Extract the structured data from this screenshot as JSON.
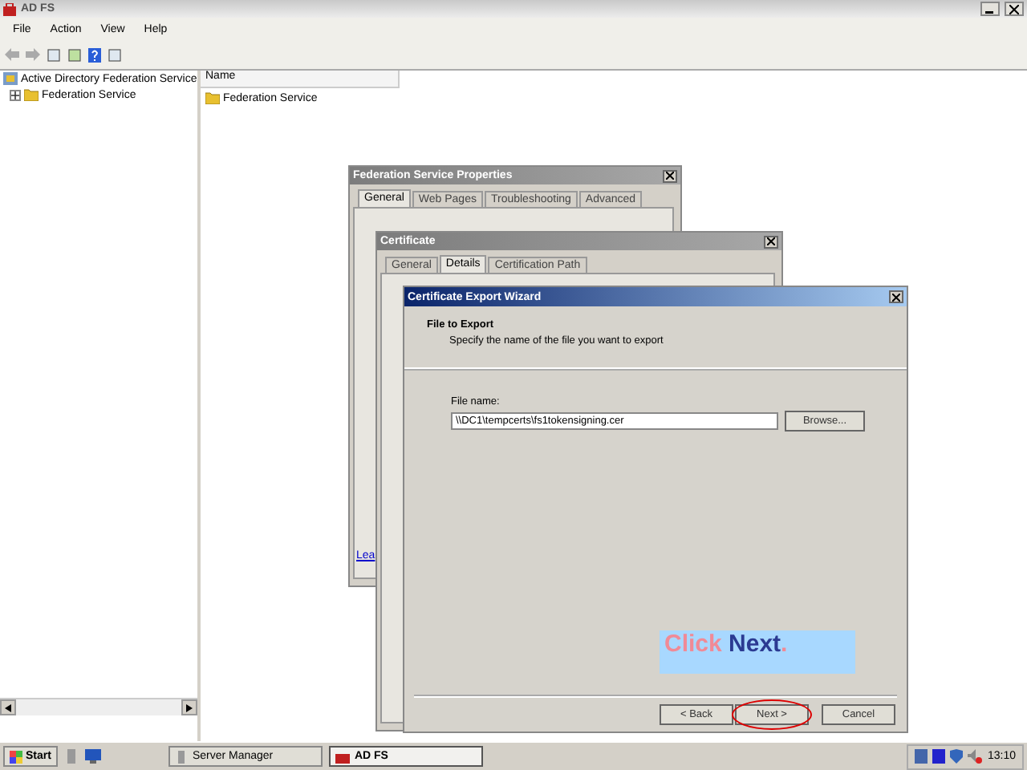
{
  "window": {
    "title": "AD FS",
    "menu": [
      {
        "label": "File"
      },
      {
        "label": "Action"
      },
      {
        "label": "View"
      },
      {
        "label": "Help"
      }
    ]
  },
  "tree": [
    {
      "label": "Active Directory Federation Service",
      "children": [
        {
          "label": "Federation Service",
          "expanded": false
        }
      ]
    }
  ],
  "list": {
    "columns": [
      "Name"
    ],
    "rows": [
      "Federation Service"
    ]
  },
  "properties_dialog": {
    "title": "Federation Service Properties",
    "tabs": [
      {
        "label": "General",
        "selected": true
      },
      {
        "label": "Web Pages",
        "selected": false
      },
      {
        "label": "Troubleshooting",
        "selected": false
      },
      {
        "label": "Advanced",
        "selected": false
      }
    ],
    "link": "Lea"
  },
  "certificate_dialog": {
    "title": "Certificate",
    "tabs": [
      {
        "label": "General",
        "selected": false
      },
      {
        "label": "Details",
        "selected": true
      },
      {
        "label": "Certification Path",
        "selected": false
      }
    ]
  },
  "wizard": {
    "title": "Certificate Export Wizard",
    "heading": "File to Export",
    "subheading": "Specify the name of the file you want to export",
    "field_label": "File name:",
    "file_name": "\\\\DC1\\tempcerts\\fs1tokensigning.cer",
    "browse": "Browse...",
    "callout": {
      "parts": [
        {
          "text": "Click",
          "color": "#f08a96"
        },
        {
          "text": " Next",
          "color": "#2b3a92"
        },
        {
          "text": ".",
          "color": "#f08a96"
        }
      ]
    },
    "buttons": [
      {
        "label": "< Back",
        "circled": false
      },
      {
        "label": "Next >",
        "circled": true
      },
      {
        "label": "Cancel",
        "circled": false
      }
    ]
  },
  "taskbar": {
    "start": "Start",
    "tasks": [
      {
        "label": "Server Manager",
        "selected": false
      },
      {
        "label": "AD FS",
        "selected": true
      }
    ],
    "clock": "13:10"
  }
}
